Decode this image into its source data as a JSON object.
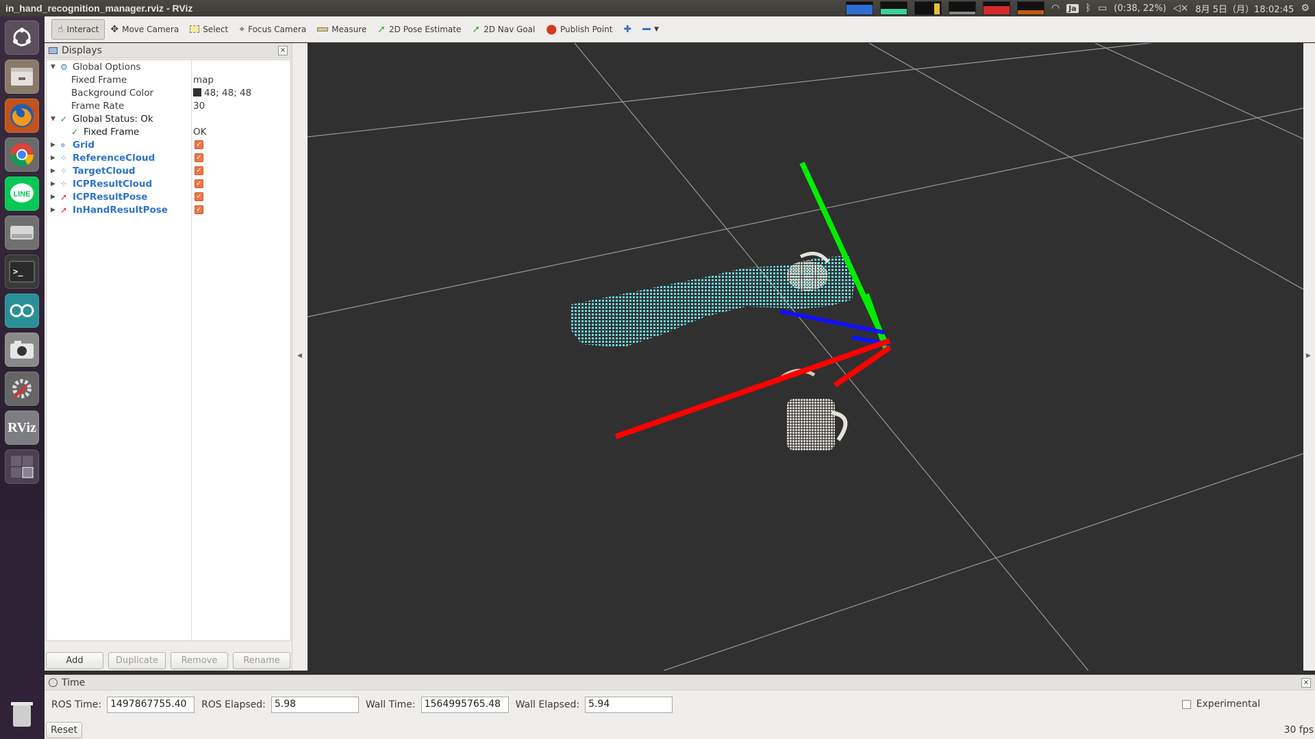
{
  "window": {
    "title": "in_hand_recognition_manager.rviz - RViz"
  },
  "tray": {
    "input_method": "Ja",
    "battery": "(0:38, 22%)",
    "datetime": "8月 5日（月）18:02:45"
  },
  "launcher": {
    "items": [
      "ubuntu-dash",
      "files",
      "firefox",
      "chrome",
      "line",
      "disk",
      "terminal",
      "arduino",
      "camera",
      "system-settings",
      "rviz",
      "workspaces",
      "trash"
    ],
    "rviz_label": "RViz",
    "line_label": "LINE"
  },
  "toolbar": {
    "interact": "Interact",
    "move_camera": "Move Camera",
    "select": "Select",
    "focus_camera": "Focus Camera",
    "measure": "Measure",
    "pose_estimate": "2D Pose Estimate",
    "nav_goal": "2D Nav Goal",
    "publish_point": "Publish Point"
  },
  "displays": {
    "title": "Displays",
    "global_options": "Global Options",
    "fixed_frame_label": "Fixed Frame",
    "fixed_frame_value": "map",
    "bg_color_label": "Background Color",
    "bg_color_value": "48; 48; 48",
    "frame_rate_label": "Frame Rate",
    "frame_rate_value": "30",
    "global_status": "Global Status: Ok",
    "status_fixed_frame": "Fixed Frame",
    "status_fixed_frame_value": "OK",
    "items": [
      {
        "label": "Grid"
      },
      {
        "label": "ReferenceCloud"
      },
      {
        "label": "TargetCloud"
      },
      {
        "label": "ICPResultCloud"
      },
      {
        "label": "ICPResultPose"
      },
      {
        "label": "InHandResultPose"
      }
    ],
    "buttons": {
      "add": "Add",
      "duplicate": "Duplicate",
      "remove": "Remove",
      "rename": "Rename"
    }
  },
  "time": {
    "title": "Time",
    "ros_time_label": "ROS Time:",
    "ros_time": "1497867755.40",
    "ros_elapsed_label": "ROS Elapsed:",
    "ros_elapsed": "5.98",
    "wall_time_label": "Wall Time:",
    "wall_time": "1564995765.48",
    "wall_elapsed_label": "Wall Elapsed:",
    "wall_elapsed": "5.94",
    "experimental": "Experimental",
    "reset": "Reset",
    "fps": "30 fps"
  },
  "colors": {
    "background": "#303030",
    "cloud_cyan": "#6fe3e8",
    "axis_x": "#ff0000",
    "axis_y": "#00ee00",
    "axis_z": "#0000ff"
  }
}
